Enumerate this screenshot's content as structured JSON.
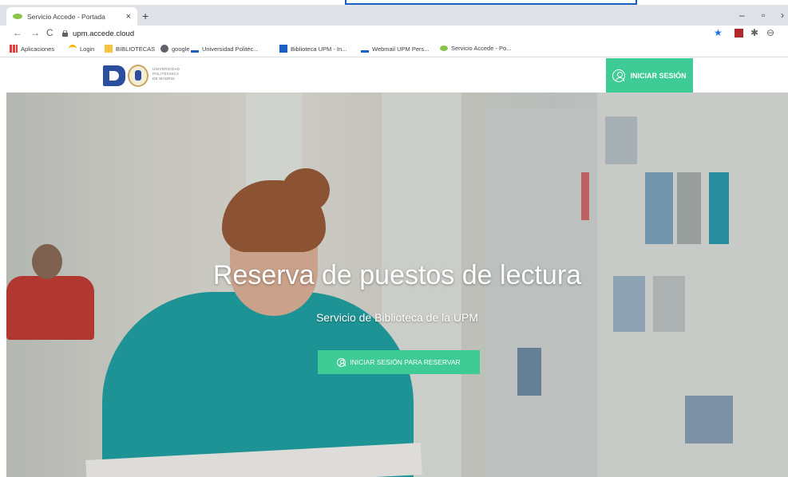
{
  "browser": {
    "tab_title": "Servicio Accede - Portada",
    "tab_close": "×",
    "new_tab": "+",
    "url": "upm.accede.cloud",
    "bookmarks": [
      {
        "label": "Aplicaciones",
        "icon": "apps-grid-icon"
      },
      {
        "label": "Login",
        "icon": "login-icon"
      },
      {
        "label": "BIBLIOTECAS",
        "icon": "folder-icon"
      },
      {
        "label": "google",
        "icon": "globe-icon"
      },
      {
        "label": "Universidad Politéc...",
        "icon": "upm-icon"
      },
      {
        "label": "Biblioteca UPM - In...",
        "icon": "library-icon"
      },
      {
        "label": "Webmail UPM Pers...",
        "icon": "upm-icon"
      },
      {
        "label": "Servicio Accede - Po...",
        "icon": "leaf-icon"
      }
    ]
  },
  "header": {
    "logo_text": [
      "UNIVERSIDAD",
      "POLITÉCNICA",
      "DE MADRID"
    ],
    "login_label": "INICIAR SESIÓN"
  },
  "hero": {
    "title": "Reserva de puestos de lectura",
    "subtitle": "Servicio de Biblioteca de la UPM",
    "cta_label": "INICIAR SESIÓN PARA RESERVAR"
  },
  "colors": {
    "accent": "#3ecb95",
    "brand_blue": "#2b4f9e"
  }
}
